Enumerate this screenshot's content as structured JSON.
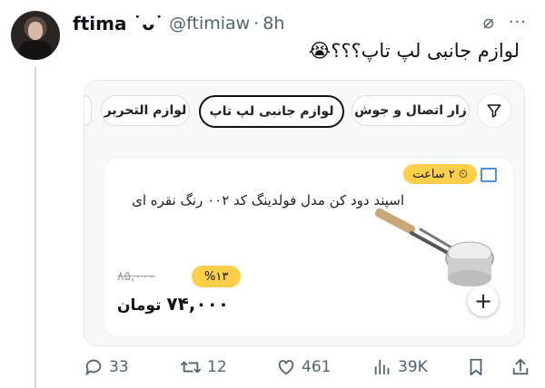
{
  "tweet": {
    "display_name": "ftima ˙ᴗ˙",
    "handle": "@ftimiaw",
    "dot": "·",
    "time": "8h",
    "text": "لوازم جانبی لپ تاپ؟؟؟😭"
  },
  "header_icons": {
    "grok": "⌀",
    "more": "···"
  },
  "card": {
    "chips": [
      "لوازم التحریر",
      "لوازم جانبی لپ تاپ",
      "زار اتصال و جوش"
    ],
    "product": {
      "time_badge": "۲ ساعت",
      "title": "اسپند دود کن مدل فولدینگ کد ۰۰۲ رنگ نقره ای",
      "discount": "%۱۳",
      "old_price": "۸۵,۰۰۰",
      "price_value": "۷۴,۰۰۰",
      "price_unit": "تومان",
      "plus": "+"
    }
  },
  "actions": {
    "replies": "33",
    "retweets": "12",
    "likes": "461",
    "views": "39K"
  },
  "icons": {
    "reply": "reply-icon",
    "retweet": "retweet-icon",
    "like": "heart-icon",
    "views": "views-icon",
    "bookmark": "bookmark-icon",
    "share": "share-icon",
    "filter": "filter-icon",
    "clock": "clock-icon",
    "store": "store-icon"
  },
  "colors": {
    "accent_yellow": "#ffcf4a",
    "muted": "#536471"
  }
}
